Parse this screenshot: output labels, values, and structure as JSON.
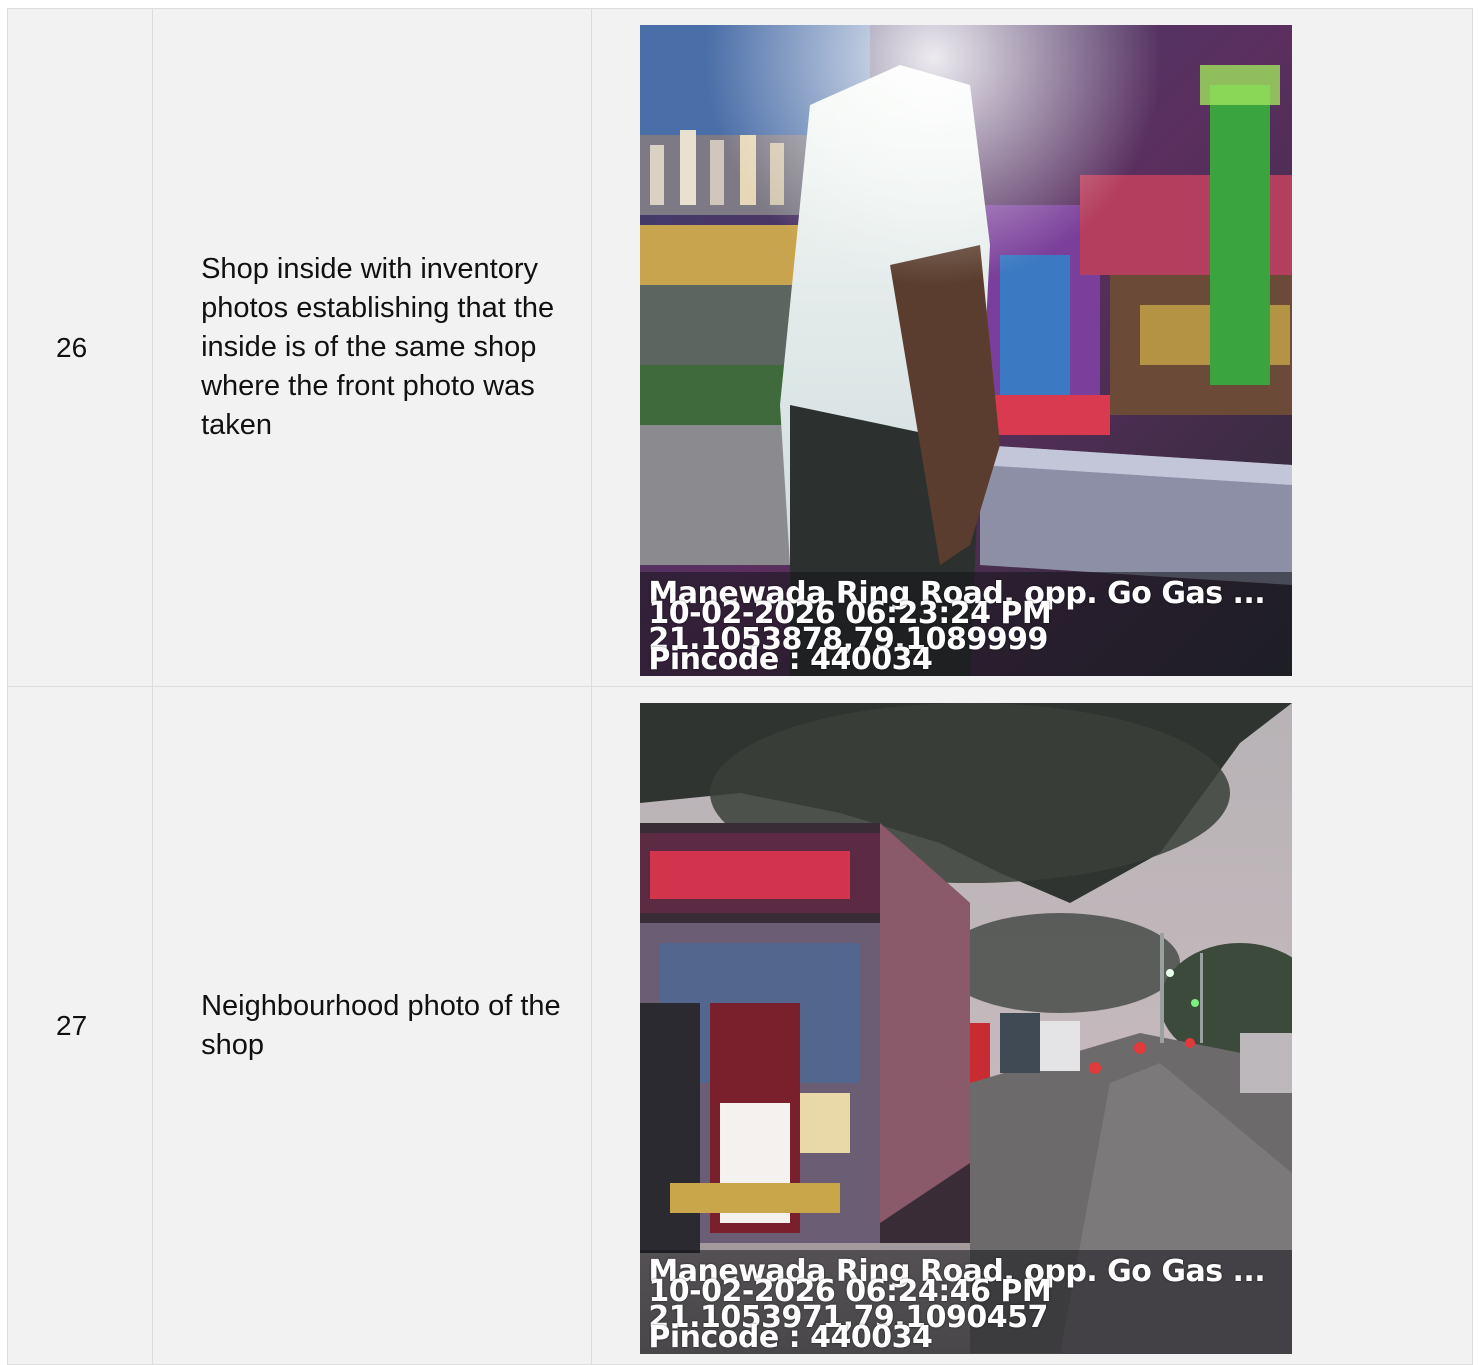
{
  "rows": [
    {
      "number": "26",
      "description": "Shop inside with inventory photos establishing that the inside is of the same shop where the front photo was taken",
      "photo": {
        "location": "Manewada Ring Road, opp. Go Gas ...",
        "timestamp": "10-02-2026 06:23:24 PM",
        "coordinates": "21.1053878,79.1089999",
        "pincode": "Pincode : 440034"
      }
    },
    {
      "number": "27",
      "description": "Neighbourhood photo of the shop",
      "photo": {
        "location": "Manewada Ring Road, opp. Go Gas ...",
        "timestamp": "10-02-2026 06:24:46 PM",
        "coordinates": "21.1053971,79.1090457",
        "pincode": "Pincode : 440034"
      }
    }
  ]
}
